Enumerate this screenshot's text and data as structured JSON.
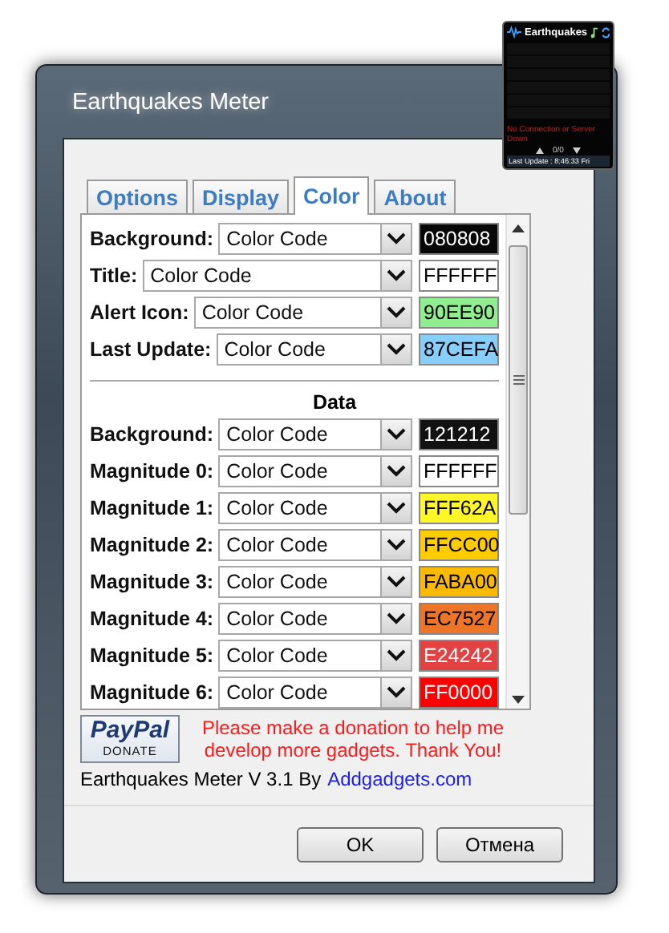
{
  "window": {
    "title": "Earthquakes Meter"
  },
  "tabs": [
    {
      "label": "Options",
      "selected": false
    },
    {
      "label": "Display",
      "selected": false
    },
    {
      "label": "Color",
      "selected": true
    },
    {
      "label": "About",
      "selected": false
    }
  ],
  "settings": {
    "general": [
      {
        "label": "Background:",
        "mode": "Color Code",
        "code": "080808",
        "color": "#080808"
      },
      {
        "label": "Title:",
        "mode": "Color Code",
        "code": "FFFFFF",
        "color": "#ffffff"
      },
      {
        "label": "Alert Icon:",
        "mode": "Color Code",
        "code": "90EE90",
        "color": "#90ee90"
      },
      {
        "label": "Last Update:",
        "mode": "Color Code",
        "code": "87CEFA",
        "color": "#87cefa"
      }
    ],
    "data_heading": "Data",
    "data": [
      {
        "label": "Background:",
        "mode": "Color Code",
        "code": "121212",
        "color": "#121212"
      },
      {
        "label": "Magnitude 0:",
        "mode": "Color Code",
        "code": "FFFFFF",
        "color": "#ffffff"
      },
      {
        "label": "Magnitude 1:",
        "mode": "Color Code",
        "code": "FFF62A",
        "color": "#fff62a"
      },
      {
        "label": "Magnitude 2:",
        "mode": "Color Code",
        "code": "FFCC00",
        "color": "#ffcc00"
      },
      {
        "label": "Magnitude 3:",
        "mode": "Color Code",
        "code": "FABA00",
        "color": "#faba00"
      },
      {
        "label": "Magnitude 4:",
        "mode": "Color Code",
        "code": "EC7527",
        "color": "#ec7527"
      },
      {
        "label": "Magnitude 5:",
        "mode": "Color Code",
        "code": "E24242",
        "color": "#e24242"
      },
      {
        "label": "Magnitude 6:",
        "mode": "Color Code",
        "code": "FF0000",
        "color": "#ff0000"
      }
    ]
  },
  "donate": {
    "brand": "PayPal",
    "button": "DONATE",
    "message": "Please make a donation to help me develop more gadgets. Thank You!"
  },
  "version": {
    "text": "Earthquakes Meter V 3.1 By",
    "link": "Addgadgets.com"
  },
  "buttons": [
    "OK",
    "Отмена"
  ],
  "gadget": {
    "title": "Earthquakes",
    "alert": "No Connection or Server Down",
    "page": "0/0",
    "last_update": "Last Update : 8:46:33 Fri"
  }
}
